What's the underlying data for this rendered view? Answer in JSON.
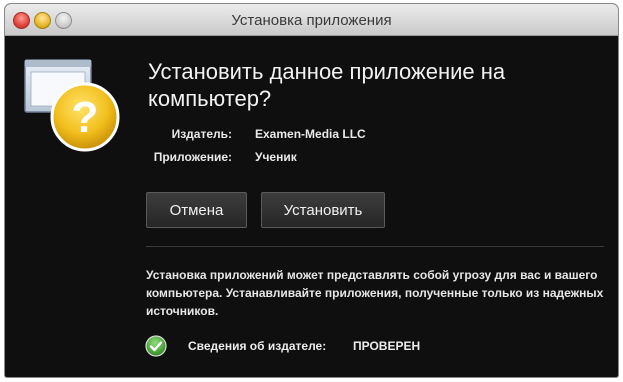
{
  "window": {
    "title": "Установка приложения"
  },
  "dialog": {
    "icon": "question-warning-icon",
    "question": "Установить данное приложение на компьютер?",
    "publisher_label": "Издатель:",
    "publisher_value": "Examen-Media LLC",
    "application_label": "Приложение:",
    "application_value": "Ученик",
    "cancel_label": "Отмена",
    "install_label": "Установить",
    "warning_text": "Установка приложений может представлять собой угрозу для вас и вашего компьютера. Устанавливайте приложения, полученные только из надежных источников.",
    "publisher_info_label": "Сведения об издателе:",
    "publisher_info_status": "ПРОВЕРЕН",
    "status_icon": "check-circle-icon"
  },
  "colors": {
    "dialog_background": "#0f0f0f",
    "question_mark_yellow": "#f2c01e",
    "check_green": "#3a9a2a"
  }
}
